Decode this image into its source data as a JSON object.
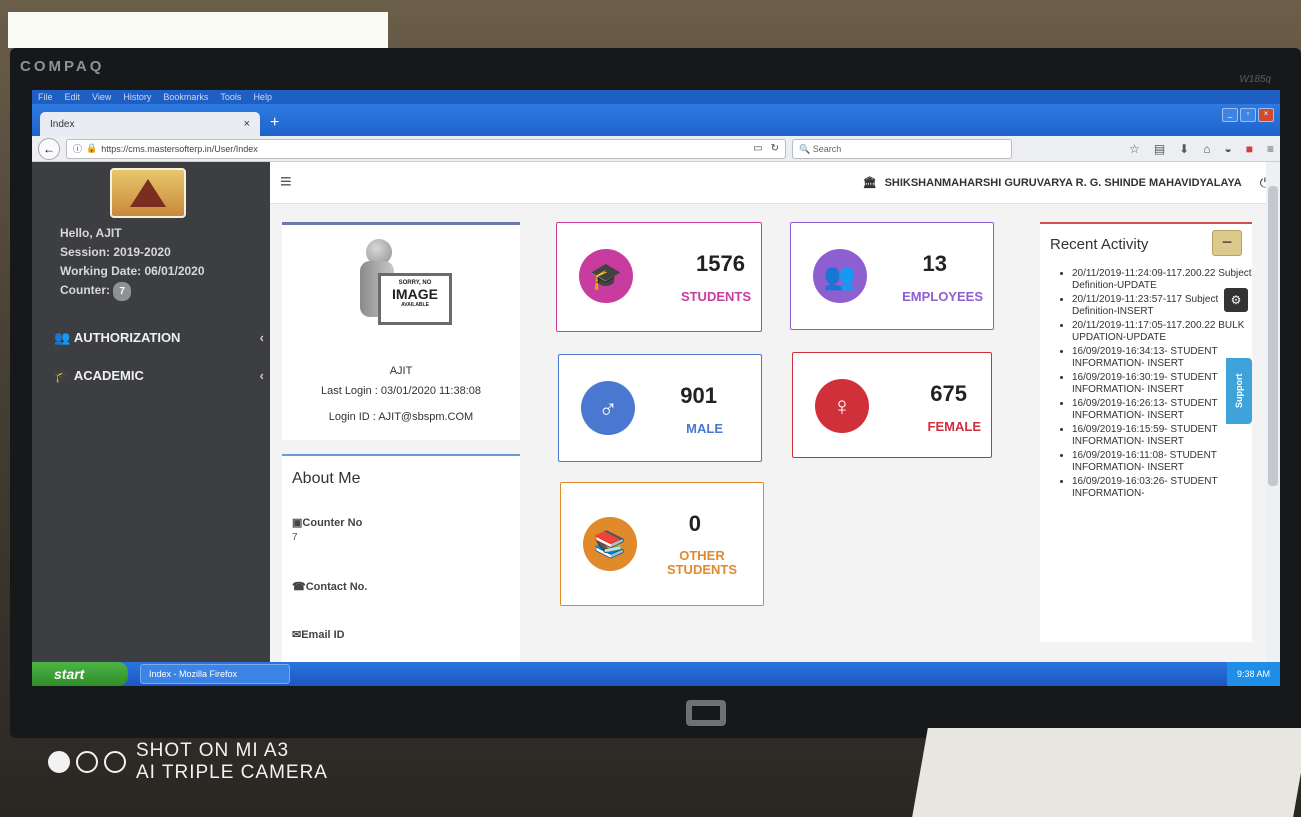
{
  "photo": {
    "brand": "COMPAQ",
    "model": "W185q",
    "footer_line1": "SHOT ON MI A3",
    "footer_line2": "AI TRIPLE CAMERA"
  },
  "browser": {
    "menu": [
      "File",
      "Edit",
      "View",
      "History",
      "Bookmarks",
      "Tools",
      "Help"
    ],
    "tab_title": "Index",
    "tab_close": "×",
    "new_tab": "+",
    "url": "https://cms.mastersofterp.in/User/Index",
    "search_placeholder": "Search"
  },
  "sidebar": {
    "greeting": "Hello, AJIT",
    "session": "Session: 2019-2020",
    "working_date": "Working Date: 06/01/2020",
    "counter_label": "Counter:",
    "counter_value": "7",
    "items": [
      {
        "label": "AUTHORIZATION",
        "icon": "users-icon"
      },
      {
        "label": "ACADEMIC",
        "icon": "graduation-cap-icon"
      }
    ]
  },
  "header": {
    "college_name": "SHIKSHANMAHARSHI GURUVARYA R. G. SHINDE MAHAVIDYALAYA"
  },
  "profile": {
    "no_image_l1": "SORRY, NO",
    "no_image_l2": "IMAGE",
    "no_image_l3": "AVAILABLE",
    "name": "AJIT",
    "last_login": "Last Login : 03/01/2020 11:38:08",
    "login_id": "Login ID : AJIT@sbspm.COM"
  },
  "about": {
    "title": "About Me",
    "counter_label": "Counter No",
    "counter_value": "7",
    "contact_label": "Contact No.",
    "email_label": "Email ID"
  },
  "stats": [
    {
      "value": "1576",
      "label": "STUDENTS",
      "color": "#c83ca0",
      "icon": "graduation-cap-icon"
    },
    {
      "value": "13",
      "label": "EMPLOYEES",
      "color": "#8e5fd0",
      "icon": "employees-icon"
    },
    {
      "value": "901",
      "label": "MALE",
      "color": "#4a78d0",
      "icon": "male-icon"
    },
    {
      "value": "675",
      "label": "FEMALE",
      "color": "#d0303a",
      "icon": "female-icon"
    },
    {
      "value": "0",
      "label_l1": "OTHER",
      "label_l2": "STUDENTS",
      "color": "#e08a2c",
      "icon": "books-icon"
    }
  ],
  "recent": {
    "title": "Recent Activity",
    "collapse": "−",
    "items": [
      "20/11/2019-11:24:09-117.200.22 Subject Definition-UPDATE",
      "20/11/2019-11:23:57-117 Subject Definition-INSERT",
      "20/11/2019-11:17:05-117.200.22 BULK UPDATION-UPDATE",
      "16/09/2019-16:34:13- STUDENT INFORMATION- INSERT",
      "16/09/2019-16:30:19- STUDENT INFORMATION- INSERT",
      "16/09/2019-16:26:13- STUDENT INFORMATION- INSERT",
      "16/09/2019-16:15:59- STUDENT INFORMATION- INSERT",
      "16/09/2019-16:11:08- STUDENT INFORMATION- INSERT",
      "16/09/2019-16:03:26- STUDENT INFORMATION-"
    ]
  },
  "widgets": {
    "support": "Support"
  },
  "taskbar": {
    "start": "start",
    "item": "Index - Mozilla Firefox",
    "clock": "9:38 AM"
  }
}
